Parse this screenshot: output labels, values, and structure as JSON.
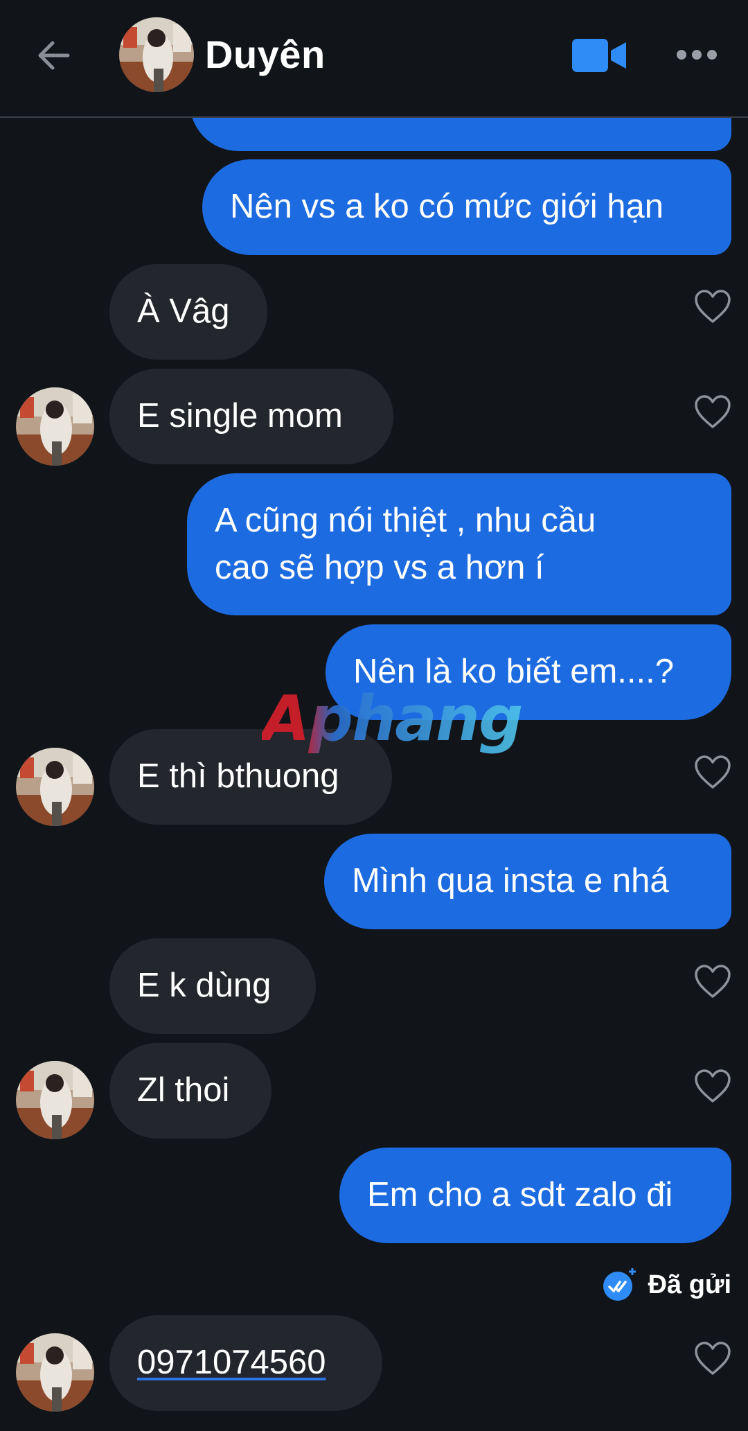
{
  "header": {
    "contact_name": "Duyên"
  },
  "messages": [
    {
      "direction": "out",
      "text": ""
    },
    {
      "direction": "out",
      "text": "Nên vs a ko có mức giới hạn"
    },
    {
      "direction": "in",
      "text": "À Vâg"
    },
    {
      "direction": "in",
      "text": "E single mom"
    },
    {
      "direction": "out",
      "lines": [
        "A cũng nói thiệt , nhu cầu",
        "cao sẽ hợp vs a hơn í"
      ]
    },
    {
      "direction": "out",
      "text": "Nên là ko biết em....?"
    },
    {
      "direction": "in",
      "text": "E thì bthuong"
    },
    {
      "direction": "out",
      "text": "Mình qua insta e nhá"
    },
    {
      "direction": "in",
      "text": "E k dùng"
    },
    {
      "direction": "in",
      "text": "Zl thoi"
    },
    {
      "direction": "out",
      "text": "Em cho a sdt zalo đi"
    },
    {
      "direction": "in",
      "text": "0971074560"
    }
  ],
  "status": {
    "sent_label": "Đã gửi"
  },
  "watermark": {
    "text": "Aphang"
  },
  "colors": {
    "background": "#111419",
    "outgoing_bubble": "#1d6be0",
    "incoming_bubble": "#23262d",
    "accent": "#2f8cf6"
  },
  "icons": [
    "back-arrow-icon",
    "video-call-icon",
    "more-options-icon",
    "heart-icon",
    "double-check-icon"
  ]
}
